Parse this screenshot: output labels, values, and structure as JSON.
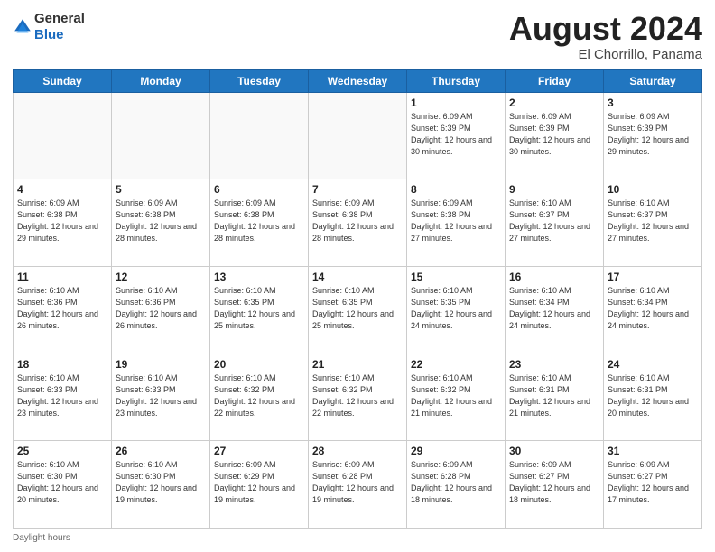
{
  "logo": {
    "general": "General",
    "blue": "Blue"
  },
  "title": {
    "month": "August 2024",
    "location": "El Chorrillo, Panama"
  },
  "days_of_week": [
    "Sunday",
    "Monday",
    "Tuesday",
    "Wednesday",
    "Thursday",
    "Friday",
    "Saturday"
  ],
  "weeks": [
    [
      {
        "day": "",
        "info": ""
      },
      {
        "day": "",
        "info": ""
      },
      {
        "day": "",
        "info": ""
      },
      {
        "day": "",
        "info": ""
      },
      {
        "day": "1",
        "sunrise": "6:09 AM",
        "sunset": "6:39 PM",
        "daylight": "12 hours and 30 minutes."
      },
      {
        "day": "2",
        "sunrise": "6:09 AM",
        "sunset": "6:39 PM",
        "daylight": "12 hours and 30 minutes."
      },
      {
        "day": "3",
        "sunrise": "6:09 AM",
        "sunset": "6:39 PM",
        "daylight": "12 hours and 29 minutes."
      }
    ],
    [
      {
        "day": "4",
        "sunrise": "6:09 AM",
        "sunset": "6:38 PM",
        "daylight": "12 hours and 29 minutes."
      },
      {
        "day": "5",
        "sunrise": "6:09 AM",
        "sunset": "6:38 PM",
        "daylight": "12 hours and 28 minutes."
      },
      {
        "day": "6",
        "sunrise": "6:09 AM",
        "sunset": "6:38 PM",
        "daylight": "12 hours and 28 minutes."
      },
      {
        "day": "7",
        "sunrise": "6:09 AM",
        "sunset": "6:38 PM",
        "daylight": "12 hours and 28 minutes."
      },
      {
        "day": "8",
        "sunrise": "6:09 AM",
        "sunset": "6:38 PM",
        "daylight": "12 hours and 27 minutes."
      },
      {
        "day": "9",
        "sunrise": "6:10 AM",
        "sunset": "6:37 PM",
        "daylight": "12 hours and 27 minutes."
      },
      {
        "day": "10",
        "sunrise": "6:10 AM",
        "sunset": "6:37 PM",
        "daylight": "12 hours and 27 minutes."
      }
    ],
    [
      {
        "day": "11",
        "sunrise": "6:10 AM",
        "sunset": "6:36 PM",
        "daylight": "12 hours and 26 minutes."
      },
      {
        "day": "12",
        "sunrise": "6:10 AM",
        "sunset": "6:36 PM",
        "daylight": "12 hours and 26 minutes."
      },
      {
        "day": "13",
        "sunrise": "6:10 AM",
        "sunset": "6:35 PM",
        "daylight": "12 hours and 25 minutes."
      },
      {
        "day": "14",
        "sunrise": "6:10 AM",
        "sunset": "6:35 PM",
        "daylight": "12 hours and 25 minutes."
      },
      {
        "day": "15",
        "sunrise": "6:10 AM",
        "sunset": "6:35 PM",
        "daylight": "12 hours and 24 minutes."
      },
      {
        "day": "16",
        "sunrise": "6:10 AM",
        "sunset": "6:34 PM",
        "daylight": "12 hours and 24 minutes."
      },
      {
        "day": "17",
        "sunrise": "6:10 AM",
        "sunset": "6:34 PM",
        "daylight": "12 hours and 24 minutes."
      }
    ],
    [
      {
        "day": "18",
        "sunrise": "6:10 AM",
        "sunset": "6:33 PM",
        "daylight": "12 hours and 23 minutes."
      },
      {
        "day": "19",
        "sunrise": "6:10 AM",
        "sunset": "6:33 PM",
        "daylight": "12 hours and 23 minutes."
      },
      {
        "day": "20",
        "sunrise": "6:10 AM",
        "sunset": "6:32 PM",
        "daylight": "12 hours and 22 minutes."
      },
      {
        "day": "21",
        "sunrise": "6:10 AM",
        "sunset": "6:32 PM",
        "daylight": "12 hours and 22 minutes."
      },
      {
        "day": "22",
        "sunrise": "6:10 AM",
        "sunset": "6:32 PM",
        "daylight": "12 hours and 21 minutes."
      },
      {
        "day": "23",
        "sunrise": "6:10 AM",
        "sunset": "6:31 PM",
        "daylight": "12 hours and 21 minutes."
      },
      {
        "day": "24",
        "sunrise": "6:10 AM",
        "sunset": "6:31 PM",
        "daylight": "12 hours and 20 minutes."
      }
    ],
    [
      {
        "day": "25",
        "sunrise": "6:10 AM",
        "sunset": "6:30 PM",
        "daylight": "12 hours and 20 minutes."
      },
      {
        "day": "26",
        "sunrise": "6:10 AM",
        "sunset": "6:30 PM",
        "daylight": "12 hours and 19 minutes."
      },
      {
        "day": "27",
        "sunrise": "6:09 AM",
        "sunset": "6:29 PM",
        "daylight": "12 hours and 19 minutes."
      },
      {
        "day": "28",
        "sunrise": "6:09 AM",
        "sunset": "6:28 PM",
        "daylight": "12 hours and 19 minutes."
      },
      {
        "day": "29",
        "sunrise": "6:09 AM",
        "sunset": "6:28 PM",
        "daylight": "12 hours and 18 minutes."
      },
      {
        "day": "30",
        "sunrise": "6:09 AM",
        "sunset": "6:27 PM",
        "daylight": "12 hours and 18 minutes."
      },
      {
        "day": "31",
        "sunrise": "6:09 AM",
        "sunset": "6:27 PM",
        "daylight": "12 hours and 17 minutes."
      }
    ]
  ],
  "footer": {
    "daylight_label": "Daylight hours"
  }
}
